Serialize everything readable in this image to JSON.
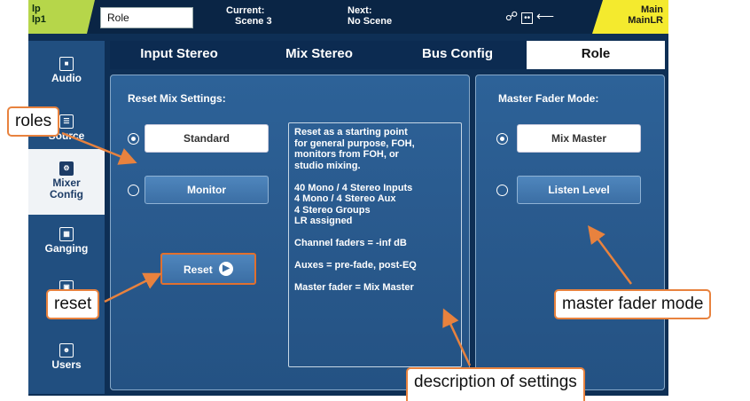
{
  "status_bar": {
    "lp_line1": "lp",
    "lp_line2": "lp1",
    "role_field": "Role",
    "current_label": "Current:",
    "current_value": "Scene 3",
    "next_label": "Next:",
    "next_value": "No Scene",
    "main_line1": "Main",
    "main_line2": "MainLR",
    "lp_color": "#b6d64a",
    "main_color": "#f4ea2e"
  },
  "sidebar": {
    "items": [
      {
        "label": "Audio",
        "icon": "audio-icon"
      },
      {
        "label": "Source",
        "icon": "source-icon"
      },
      {
        "label": "Mixer Config",
        "icon": "mixer-config-icon",
        "active": true
      },
      {
        "label": "Ganging",
        "icon": "ganging-icon"
      },
      {
        "label": "",
        "icon": "control-icon"
      },
      {
        "label": "Users",
        "icon": "users-icon"
      }
    ]
  },
  "tabs": [
    "Input Stereo",
    "Mix Stereo",
    "Bus Config",
    "Role"
  ],
  "active_tab": "Role",
  "reset_panel": {
    "title": "Reset Mix Settings:",
    "options": [
      "Standard",
      "Monitor"
    ],
    "selected": "Standard",
    "reset_label": "Reset"
  },
  "description": "Reset as a starting point\nfor general purpose, FOH,\nmonitors from FOH, or\nstudio mixing.\n\n40 Mono / 4 Stereo Inputs\n4 Mono / 4 Stereo Aux\n4 Stereo Groups\nLR assigned\n\nChannel faders = -inf dB\n\nAuxes = pre-fade, post-EQ\n\nMaster fader = Mix Master",
  "master_panel": {
    "title": "Master Fader Mode:",
    "options": [
      "Mix Master",
      "Listen Level"
    ],
    "selected": "Mix Master"
  },
  "callouts": {
    "roles": "roles",
    "reset": "reset",
    "master": "master fader mode",
    "description": "description of settings",
    "color": "#e8823e"
  }
}
